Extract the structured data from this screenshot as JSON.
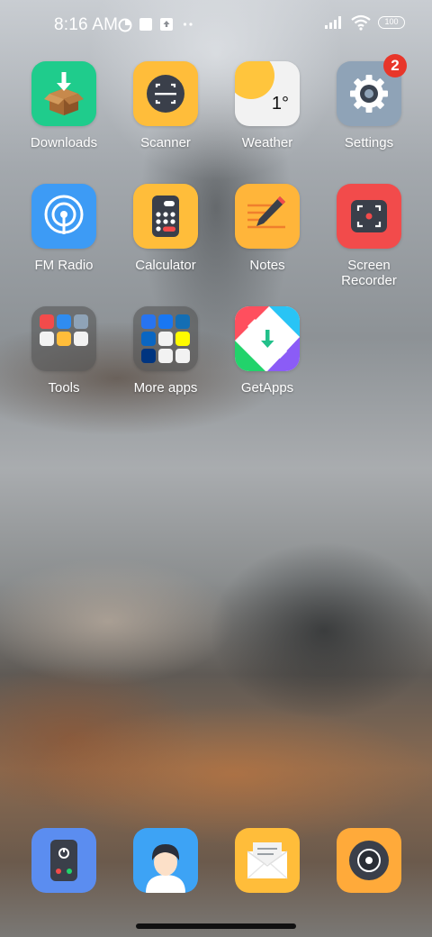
{
  "status_bar": {
    "time": "8:16 AM",
    "battery": "100",
    "icons": [
      "data-saver-icon",
      "square-notification-icon",
      "upload-notification-icon",
      "more-dots-icon",
      "signal-icon",
      "wifi-icon",
      "battery-icon"
    ]
  },
  "apps": [
    {
      "label": "Downloads",
      "icon": "downloads-icon",
      "color": "#1fcc8c"
    },
    {
      "label": "Scanner",
      "icon": "scanner-icon",
      "color": "#ffbd3a"
    },
    {
      "label": "Weather",
      "icon": "weather-icon",
      "color": "#f2f2f2",
      "temperature": "1°"
    },
    {
      "label": "Settings",
      "icon": "settings-icon",
      "color": "#8fa3b7",
      "badge": "2"
    },
    {
      "label": "FM Radio",
      "icon": "fm-radio-icon",
      "color": "#3d9bf5"
    },
    {
      "label": "Calculator",
      "icon": "calculator-icon",
      "color": "#ffbd3a"
    },
    {
      "label": "Notes",
      "icon": "notes-icon",
      "color": "#ffb53a"
    },
    {
      "label": "Screen\nRecorder",
      "line1": "Screen",
      "line2": "Recorder",
      "icon": "screen-recorder-icon",
      "color": "#f24b4b"
    },
    {
      "label": "Tools",
      "icon": "tools-folder-icon"
    },
    {
      "label": "More apps",
      "icon": "more-apps-folder-icon"
    },
    {
      "label": "GetApps",
      "icon": "getapps-icon"
    }
  ],
  "dock": [
    {
      "icon": "phone-icon",
      "color": "#5b8df0"
    },
    {
      "icon": "contacts-icon",
      "color": "#3da3f5"
    },
    {
      "icon": "messages-icon",
      "color": "#ffbd3a"
    },
    {
      "icon": "camera-icon",
      "color": "#ffaa3a"
    }
  ],
  "colors": {
    "badge": "#e8362a",
    "label": "#ffffff"
  }
}
